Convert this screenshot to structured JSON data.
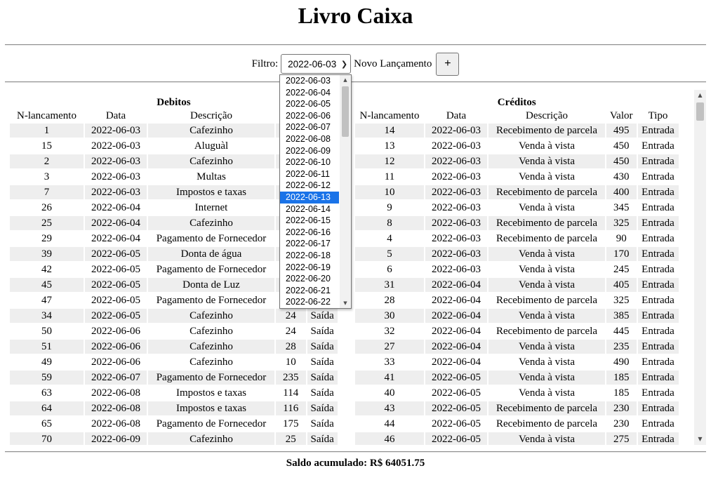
{
  "page": {
    "title": "Livro Caixa",
    "filter_label": "Filtro:",
    "filter_value": "2022-06-03",
    "new_entry_label": "Novo Lançamento",
    "add_button": "+"
  },
  "dropdown": {
    "options": [
      "2022-06-03",
      "2022-06-04",
      "2022-06-05",
      "2022-06-06",
      "2022-06-07",
      "2022-06-08",
      "2022-06-09",
      "2022-06-10",
      "2022-06-11",
      "2022-06-12",
      "2022-06-13",
      "2022-06-14",
      "2022-06-15",
      "2022-06-16",
      "2022-06-17",
      "2022-06-18",
      "2022-06-19",
      "2022-06-20",
      "2022-06-21",
      "2022-06-22"
    ],
    "highlighted": "2022-06-13"
  },
  "debitos": {
    "caption": "Debitos",
    "columns": [
      "N-lancamento",
      "Data",
      "Descrição",
      "Valor",
      "Tipo"
    ],
    "rows": [
      [
        "1",
        "2022-06-03",
        "Cafezinho",
        "",
        ""
      ],
      [
        "15",
        "2022-06-03",
        "Aluguàl",
        "",
        ""
      ],
      [
        "2",
        "2022-06-03",
        "Cafezinho",
        "",
        ""
      ],
      [
        "3",
        "2022-06-03",
        "Multas",
        "",
        ""
      ],
      [
        "7",
        "2022-06-03",
        "Impostos e taxas",
        "",
        ""
      ],
      [
        "26",
        "2022-06-04",
        "Internet",
        "",
        ""
      ],
      [
        "25",
        "2022-06-04",
        "Cafezinho",
        "",
        ""
      ],
      [
        "29",
        "2022-06-04",
        "Pagamento de Fornecedor",
        "",
        ""
      ],
      [
        "39",
        "2022-06-05",
        "Donta de água",
        "",
        ""
      ],
      [
        "42",
        "2022-06-05",
        "Pagamento de Fornecedor",
        "",
        ""
      ],
      [
        "45",
        "2022-06-05",
        "Donta de Luz",
        "",
        ""
      ],
      [
        "47",
        "2022-06-05",
        "Pagamento de Fornecedor",
        "",
        ""
      ],
      [
        "34",
        "2022-06-05",
        "Cafezinho",
        "24",
        "Saída"
      ],
      [
        "50",
        "2022-06-06",
        "Cafezinho",
        "24",
        "Saída"
      ],
      [
        "51",
        "2022-06-06",
        "Cafezinho",
        "28",
        "Saída"
      ],
      [
        "49",
        "2022-06-06",
        "Cafezinho",
        "10",
        "Saída"
      ],
      [
        "59",
        "2022-06-07",
        "Pagamento de Fornecedor",
        "235",
        "Saída"
      ],
      [
        "63",
        "2022-06-08",
        "Impostos e taxas",
        "114",
        "Saída"
      ],
      [
        "64",
        "2022-06-08",
        "Impostos e taxas",
        "116",
        "Saída"
      ],
      [
        "65",
        "2022-06-08",
        "Pagamento de Fornecedor",
        "175",
        "Saída"
      ],
      [
        "70",
        "2022-06-09",
        "Cafezinho",
        "25",
        "Saída"
      ]
    ]
  },
  "creditos": {
    "caption": "Créditos",
    "columns": [
      "N-lancamento",
      "Data",
      "Descrição",
      "Valor",
      "Tipo"
    ],
    "rows": [
      [
        "14",
        "2022-06-03",
        "Recebimento de parcela",
        "495",
        "Entrada"
      ],
      [
        "13",
        "2022-06-03",
        "Venda à vista",
        "450",
        "Entrada"
      ],
      [
        "12",
        "2022-06-03",
        "Venda à vista",
        "450",
        "Entrada"
      ],
      [
        "11",
        "2022-06-03",
        "Venda à vista",
        "430",
        "Entrada"
      ],
      [
        "10",
        "2022-06-03",
        "Recebimento de parcela",
        "400",
        "Entrada"
      ],
      [
        "9",
        "2022-06-03",
        "Venda à vista",
        "345",
        "Entrada"
      ],
      [
        "8",
        "2022-06-03",
        "Recebimento de parcela",
        "325",
        "Entrada"
      ],
      [
        "4",
        "2022-06-03",
        "Recebimento de parcela",
        "90",
        "Entrada"
      ],
      [
        "5",
        "2022-06-03",
        "Venda à vista",
        "170",
        "Entrada"
      ],
      [
        "6",
        "2022-06-03",
        "Venda à vista",
        "245",
        "Entrada"
      ],
      [
        "31",
        "2022-06-04",
        "Venda à vista",
        "405",
        "Entrada"
      ],
      [
        "28",
        "2022-06-04",
        "Recebimento de parcela",
        "325",
        "Entrada"
      ],
      [
        "30",
        "2022-06-04",
        "Venda à vista",
        "385",
        "Entrada"
      ],
      [
        "32",
        "2022-06-04",
        "Recebimento de parcela",
        "445",
        "Entrada"
      ],
      [
        "27",
        "2022-06-04",
        "Venda à vista",
        "235",
        "Entrada"
      ],
      [
        "33",
        "2022-06-04",
        "Venda à vista",
        "490",
        "Entrada"
      ],
      [
        "41",
        "2022-06-05",
        "Venda à vista",
        "185",
        "Entrada"
      ],
      [
        "40",
        "2022-06-05",
        "Venda à vista",
        "185",
        "Entrada"
      ],
      [
        "43",
        "2022-06-05",
        "Recebimento de parcela",
        "230",
        "Entrada"
      ],
      [
        "44",
        "2022-06-05",
        "Recebimento de parcela",
        "230",
        "Entrada"
      ],
      [
        "46",
        "2022-06-05",
        "Venda à vista",
        "275",
        "Entrada"
      ]
    ]
  },
  "footer": {
    "saldo": "Saldo acumulado: R$ 64051.75"
  },
  "colors": {
    "row_stripe": "#eeeeee",
    "selection": "#1a73e8",
    "scrollbar_track": "#f1f1f1",
    "scrollbar_thumb": "#c1c1c1"
  }
}
